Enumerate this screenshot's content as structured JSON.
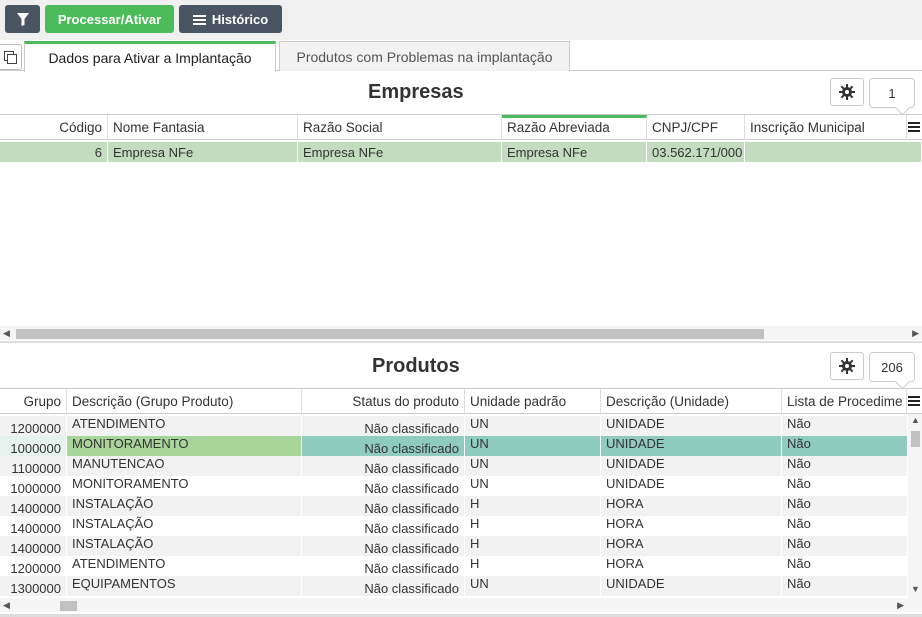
{
  "toolbar": {
    "filter_icon": "filter-icon",
    "process_label": "Processar/Ativar",
    "history_label": "Histórico",
    "history_icon": "list-icon"
  },
  "tabs": [
    {
      "label": "Dados para Ativar a Implantação",
      "active": true
    },
    {
      "label": "Produtos com Problemas na implantação",
      "active": false
    }
  ],
  "empresas": {
    "title": "Empresas",
    "count": "1",
    "columns": [
      "Código",
      "Nome Fantasia",
      "Razão Social",
      "Razão Abreviada",
      "CNPJ/CPF",
      "Inscrição Municipal"
    ],
    "sorted_column": "Razão Abreviada",
    "rows": [
      {
        "codigo": "6",
        "nome_fantasia": "Empresa NFe",
        "razao_social": "Empresa NFe",
        "razao_abreviada": "Empresa NFe",
        "cnpj": "03.562.171/000",
        "inscricao": ""
      }
    ]
  },
  "produtos": {
    "title": "Produtos",
    "count": "206",
    "columns": [
      "Grupo",
      "Descrição (Grupo Produto)",
      "Status do produto",
      "Unidade padrão",
      "Descrição (Unidade)",
      "Lista de Procedime"
    ],
    "rows": [
      {
        "grupo": "1200000",
        "descricao": "ATENDIMENTO",
        "status": "Não classificado",
        "unidade": "UN",
        "desc_unidade": "UNIDADE",
        "lista": "Não"
      },
      {
        "grupo": "1000000",
        "descricao": "MONITORAMENTO",
        "status": "Não classificado",
        "unidade": "UN",
        "desc_unidade": "UNIDADE",
        "lista": "Não"
      },
      {
        "grupo": "1100000",
        "descricao": "MANUTENCAO",
        "status": "Não classificado",
        "unidade": "UN",
        "desc_unidade": "UNIDADE",
        "lista": "Não"
      },
      {
        "grupo": "1000000",
        "descricao": "MONITORAMENTO",
        "status": "Não classificado",
        "unidade": "UN",
        "desc_unidade": "UNIDADE",
        "lista": "Não"
      },
      {
        "grupo": "1400000",
        "descricao": "INSTALAÇÃO",
        "status": "Não classificado",
        "unidade": "H",
        "desc_unidade": "HORA",
        "lista": "Não"
      },
      {
        "grupo": "1400000",
        "descricao": "INSTALAÇÃO",
        "status": "Não classificado",
        "unidade": "H",
        "desc_unidade": "HORA",
        "lista": "Não"
      },
      {
        "grupo": "1400000",
        "descricao": "INSTALAÇÃO",
        "status": "Não classificado",
        "unidade": "H",
        "desc_unidade": "HORA",
        "lista": "Não"
      },
      {
        "grupo": "1200000",
        "descricao": "ATENDIMENTO",
        "status": "Não classificado",
        "unidade": "H",
        "desc_unidade": "HORA",
        "lista": "Não"
      },
      {
        "grupo": "1300000",
        "descricao": "EQUIPAMENTOS",
        "status": "Não classificado",
        "unidade": "UN",
        "desc_unidade": "UNIDADE",
        "lista": "Não"
      }
    ]
  },
  "colors": {
    "accent_green": "#4cbb5a",
    "toolbar_dark": "#4a5563",
    "selected_row_green": "#c3dcc0",
    "selected_row_teal": "#8fcbbf",
    "selected_cell_green": "#a8d69a"
  }
}
